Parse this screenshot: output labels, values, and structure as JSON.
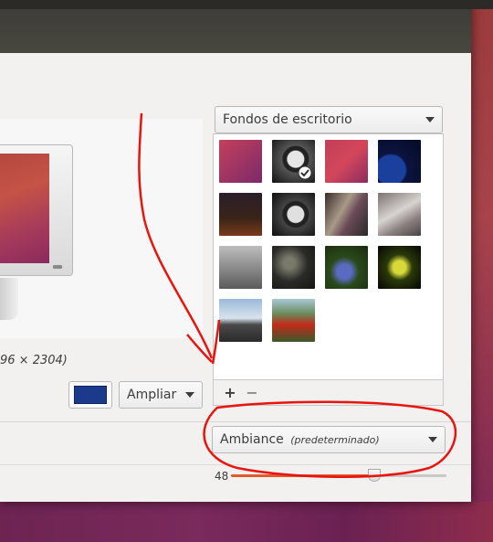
{
  "background_selector": {
    "label": "Fondos de escritorio"
  },
  "preview": {
    "resolution_text": "96 × 2304)"
  },
  "color": {
    "value": "#1b3a8c"
  },
  "zoom_mode": {
    "label": "Ampliar"
  },
  "gallery": {
    "thumbnails": [
      {
        "name": "purple-gradient",
        "selected": false
      },
      {
        "name": "clock-bw",
        "selected": true
      },
      {
        "name": "red-purple-gradient",
        "selected": false
      },
      {
        "name": "blue-planet",
        "selected": false
      },
      {
        "name": "night-sky",
        "selected": false
      },
      {
        "name": "clock-bw-2",
        "selected": false
      },
      {
        "name": "bottles",
        "selected": false
      },
      {
        "name": "frost-plant",
        "selected": false
      },
      {
        "name": "grey-landscape",
        "selected": false
      },
      {
        "name": "dark-flowers",
        "selected": false
      },
      {
        "name": "blue-flowers",
        "selected": false
      },
      {
        "name": "yellow-flower",
        "selected": false
      },
      {
        "name": "mountain-sky",
        "selected": false
      },
      {
        "name": "red-poppies",
        "selected": false
      }
    ],
    "add_label": "+",
    "remove_label": "−"
  },
  "theme": {
    "name": "Ambiance",
    "note": "(predeterminado)"
  },
  "launcher_icon_size": {
    "value": 48,
    "min": 16,
    "max": 64
  },
  "annotation": {
    "color": "#e8140e"
  }
}
